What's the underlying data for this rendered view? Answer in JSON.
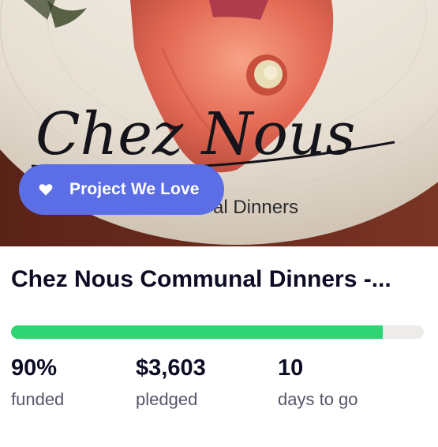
{
  "badge": {
    "label": "Project We Love",
    "icon": "heart-icon",
    "color": "#5b6ee6"
  },
  "hero": {
    "logo_text": "Chez Nous",
    "logo_subtitle": "al Dinners"
  },
  "project": {
    "title": "Chez Nous Communal Dinners -...",
    "progress_percent": 90,
    "progress_color": "#2fd574"
  },
  "stats": [
    {
      "value": "90%",
      "label": "funded"
    },
    {
      "value": "$3,603",
      "label": "pledged"
    },
    {
      "value": "10",
      "label": "days to go"
    }
  ]
}
